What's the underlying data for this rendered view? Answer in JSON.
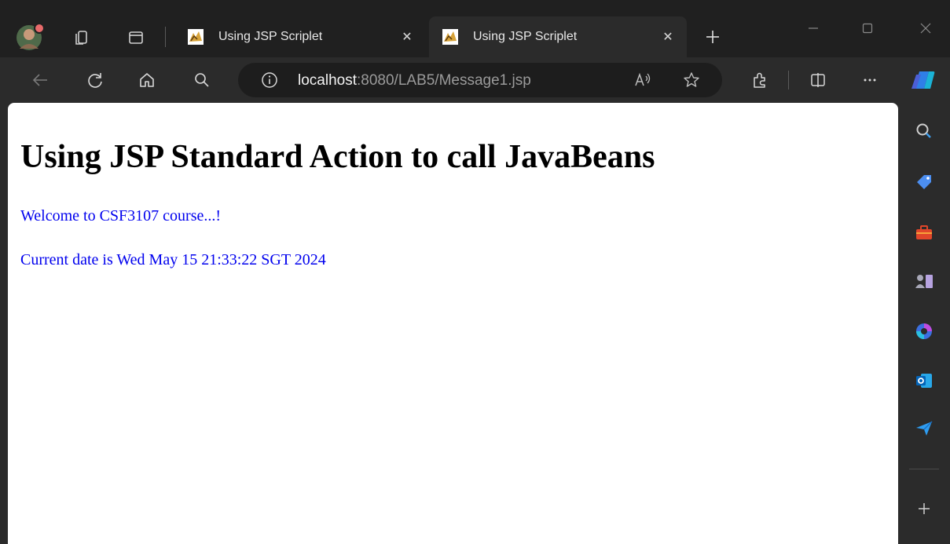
{
  "tabs": [
    {
      "title": "Using JSP Scriplet",
      "active": false
    },
    {
      "title": "Using JSP Scriplet",
      "active": true
    }
  ],
  "address": {
    "host": "localhost",
    "path": ":8080/LAB5/Message1.jsp"
  },
  "page": {
    "heading": "Using JSP Standard Action to call JavaBeans",
    "welcome": "Welcome to CSF3107 course...!",
    "date": "Current date is Wed May 15 21:33:22 SGT 2024"
  },
  "colors": {
    "link_blue": "#0000ee",
    "browser_dark": "#202020",
    "toolbar_dark": "#2b2b2b"
  },
  "sidebar": {
    "icons": [
      "search-icon",
      "shopping-tag-icon",
      "toolbox-icon",
      "games-icon",
      "copilot-icon",
      "outlook-icon",
      "send-icon",
      "add-icon"
    ]
  }
}
